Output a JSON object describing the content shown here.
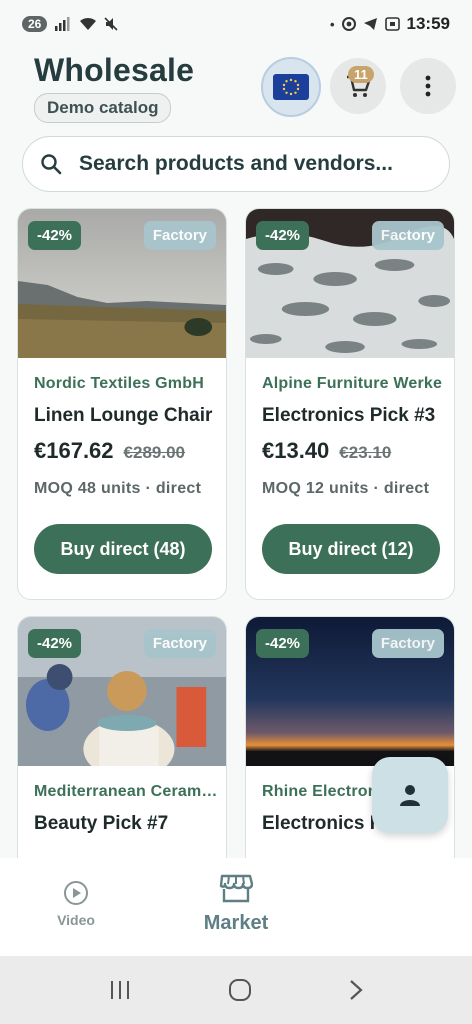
{
  "status_bar": {
    "notification_count": "26",
    "time": "13:59",
    "left_icons": [
      "signal-icon",
      "wifi-icon",
      "mute-icon"
    ],
    "right_icons": [
      "dot-icon",
      "chrome-icon",
      "telegram-icon",
      "screenshot-icon"
    ]
  },
  "header": {
    "title": "Wholesale",
    "subtitle": "Demo catalog",
    "cart_count": "11"
  },
  "search": {
    "placeholder": "Search products and vendors..."
  },
  "products": [
    {
      "discount": "-42%",
      "tag": "Factory",
      "vendor": "Nordic Textiles GmbH",
      "name": "Linen Lounge Chair",
      "price": "€167.62",
      "old_price": "€289.00",
      "moq": "MOQ 48 units · direct",
      "buy_label": "Buy direct (48)",
      "image": "grassland-mountains"
    },
    {
      "discount": "-42%",
      "tag": "Factory",
      "vendor": "Alpine Furniture Werke",
      "name": "Electronics Pick #3",
      "price": "€13.40",
      "old_price": "€23.10",
      "moq": "MOQ 12 units · direct",
      "buy_label": "Buy direct (12)",
      "image": "ocean-waves"
    },
    {
      "discount": "-42%",
      "tag": "Factory",
      "vendor": "Mediterranean Ceramics",
      "name": "Beauty Pick #7",
      "price": "",
      "old_price": "",
      "moq": "",
      "buy_label": "",
      "image": "street-scooters"
    },
    {
      "discount": "-42%",
      "tag": "Factory",
      "vendor": "Rhine Electronics",
      "name": "Electronics Hub",
      "price": "",
      "old_price": "",
      "moq": "",
      "buy_label": "",
      "image": "sunset-horizon"
    }
  ],
  "bottom_nav": {
    "video_label": "Video",
    "market_label": "Market"
  },
  "colors": {
    "primary_green": "#3d7058",
    "factory_tag": "#a8c5cc",
    "title_dark": "#263d3f"
  }
}
